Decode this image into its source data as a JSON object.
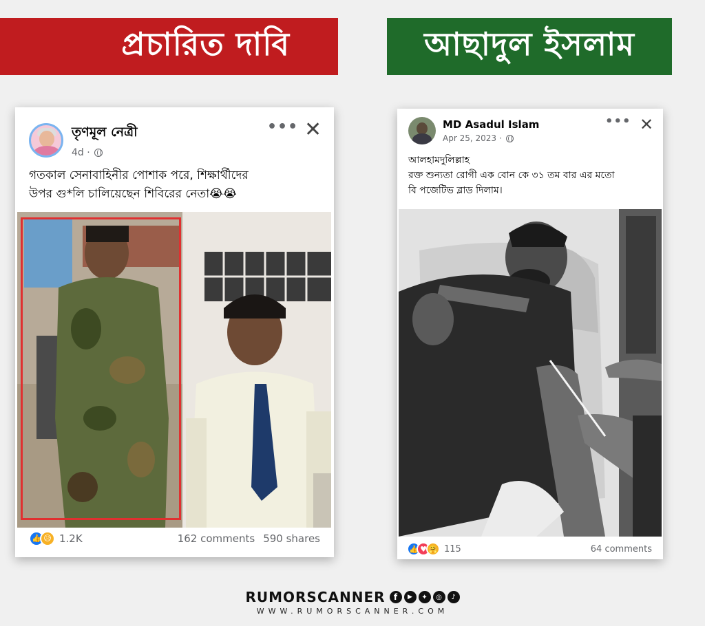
{
  "banners": {
    "left": "প্রচারিত দাবি",
    "right": "আছাদুল ইসলাম"
  },
  "post1": {
    "author": "তৃণমূল নেত্রী",
    "time": "4d ·",
    "text_line1": "গতকাল সেনাবাহিনীর পোশাক পরে, শিক্ষার্থীদের",
    "text_line2": "উপর গু*লি চালিয়েছেন শিবিরের নেতা😭😭",
    "reactions_count": "1.2K",
    "comments": "162 comments",
    "shares": "590 shares",
    "more_icon": "more-dots-icon",
    "close_icon": "close-icon"
  },
  "post2": {
    "author": "MD Asadul Islam",
    "time": "Apr 25, 2023 ·",
    "text_line1": "আলহামদুলিল্লাহ",
    "text_line2": "রক্ত শুন্যতা রোগী এক বোন কে ৩১ তম বার এর মতো",
    "text_line3": "বি পজেটিভ ব্লাড দিলাম।",
    "reactions_count": "115",
    "comments": "64 comments"
  },
  "brand": {
    "name": "RUMORSCANNER",
    "url": "WWW.RUMORSCANNER.COM"
  },
  "colors": {
    "red_banner": "#c01c1f",
    "green_banner": "#1f6b2a",
    "highlight_box": "#e03030"
  }
}
